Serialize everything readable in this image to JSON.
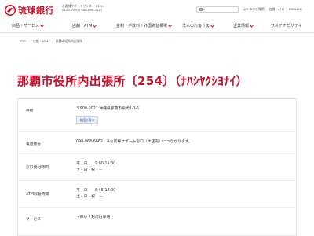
{
  "header": {
    "logo_name": "琉球銀行",
    "info_lines": [
      "お客様サポートセンター 0120-",
      "0120-0000 / 098-866-4121"
    ],
    "search_placeholder": "検索",
    "links": [
      "よくあるご質問",
      "店舗・ATM",
      "ENGLISH"
    ],
    "brand_color": "#c8102e"
  },
  "nav": {
    "items": [
      "商品・サービス",
      "店舗・ATM",
      "金利・手数料・外国為替相場",
      "法人のお客さま",
      "企業情報",
      "サステナビリティ"
    ]
  },
  "breadcrumb": [
    "TOP",
    "店舗・ATM",
    "那覇市役所内出張所"
  ],
  "page": {
    "title": "那覇市役所内出張所〔254〕（ﾅﾊｼﾔｸｼﾖﾅｲ）"
  },
  "details": {
    "address_label": "住所",
    "address_value": "〒900-0021 沖縄県那覇市泉崎1-1-1",
    "map_button": "地図を見る",
    "phone_label": "電話番号",
    "phone_value": "098-868-6662　※お客様サポート窓口（本店内）につながります。",
    "teller_label": "窓口受付時間",
    "teller_lines": [
      "平　日　　9:00-15:00",
      "土・日・祝　－"
    ],
    "atm_label": "ATM稼動時間",
    "atm_lines": [
      "平　日　　8:45-18:00",
      "土・日・祝　－"
    ],
    "service_label": "サービス",
    "service_value": "・車いす対応駐車場"
  }
}
